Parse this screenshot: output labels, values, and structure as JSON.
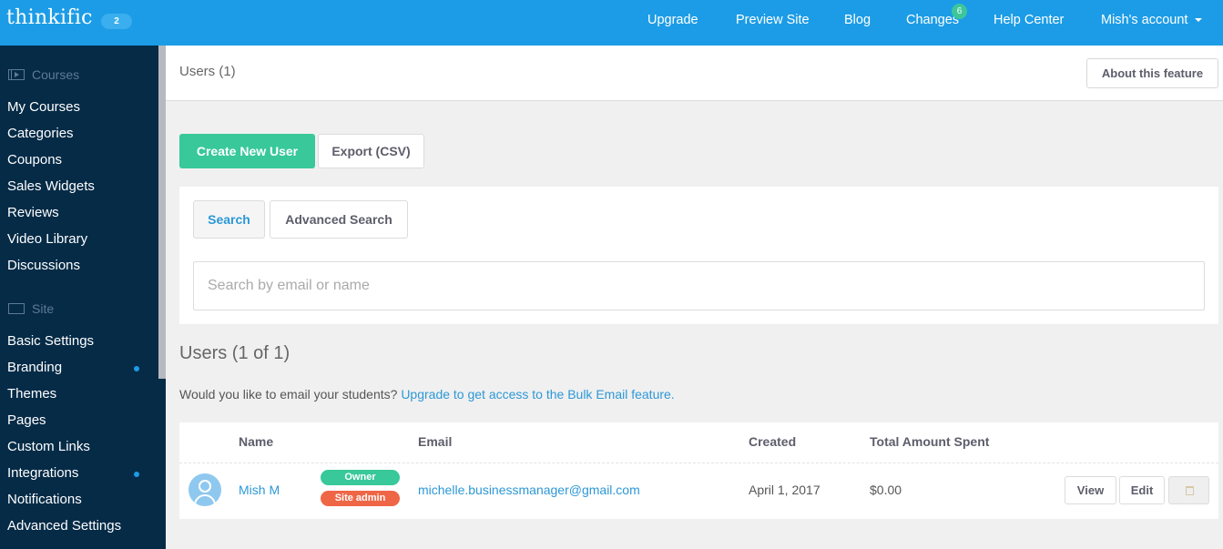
{
  "header": {
    "logo": "thinkific",
    "logo_badge": "2",
    "nav": [
      {
        "label": "Upgrade"
      },
      {
        "label": "Preview Site"
      },
      {
        "label": "Blog"
      },
      {
        "label": "Changes",
        "badge": "6"
      },
      {
        "label": "Help Center"
      },
      {
        "label": "Mish's account"
      }
    ]
  },
  "sidebar": {
    "sections": [
      {
        "label": "Courses",
        "icon": "video-icon"
      },
      {
        "label": "Site",
        "icon": "window-icon"
      }
    ],
    "courses_items": [
      {
        "label": "My Courses"
      },
      {
        "label": "Categories"
      },
      {
        "label": "Coupons"
      },
      {
        "label": "Sales Widgets"
      },
      {
        "label": "Reviews"
      },
      {
        "label": "Video Library"
      },
      {
        "label": "Discussions"
      }
    ],
    "site_items": [
      {
        "label": "Basic Settings"
      },
      {
        "label": "Branding",
        "dot": true
      },
      {
        "label": "Themes"
      },
      {
        "label": "Pages"
      },
      {
        "label": "Custom Links"
      },
      {
        "label": "Integrations",
        "dot": true
      },
      {
        "label": "Notifications"
      },
      {
        "label": "Advanced Settings"
      }
    ]
  },
  "page": {
    "title": "Users (1)",
    "about_button": "About this feature",
    "create_button": "Create New User",
    "export_button": "Export (CSV)"
  },
  "search": {
    "tabs": [
      {
        "label": "Search",
        "active": true
      },
      {
        "label": "Advanced Search",
        "active": false
      }
    ],
    "placeholder": "Search by email or name",
    "value": ""
  },
  "users": {
    "title": "Users (1 of 1)",
    "upsell_text": "Would you like to email your students?",
    "upsell_link": "Upgrade to get access to the Bulk Email feature.",
    "columns": [
      "Name",
      "Email",
      "Created",
      "Total Amount Spent"
    ],
    "rows": [
      {
        "name": "Mish M",
        "badges": [
          "Owner",
          "Site admin"
        ],
        "email": "michelle.businessmanager@gmail.com",
        "created": "April 1, 2017",
        "total_spent": "$0.00",
        "actions": [
          "View",
          "Edit"
        ]
      }
    ]
  },
  "colors": {
    "brand_blue": "#1c9ce6",
    "sidebar_navy": "#052b47",
    "primary_green": "#38c89a",
    "admin_red": "#ef6646",
    "link_blue": "#2d98d6"
  }
}
